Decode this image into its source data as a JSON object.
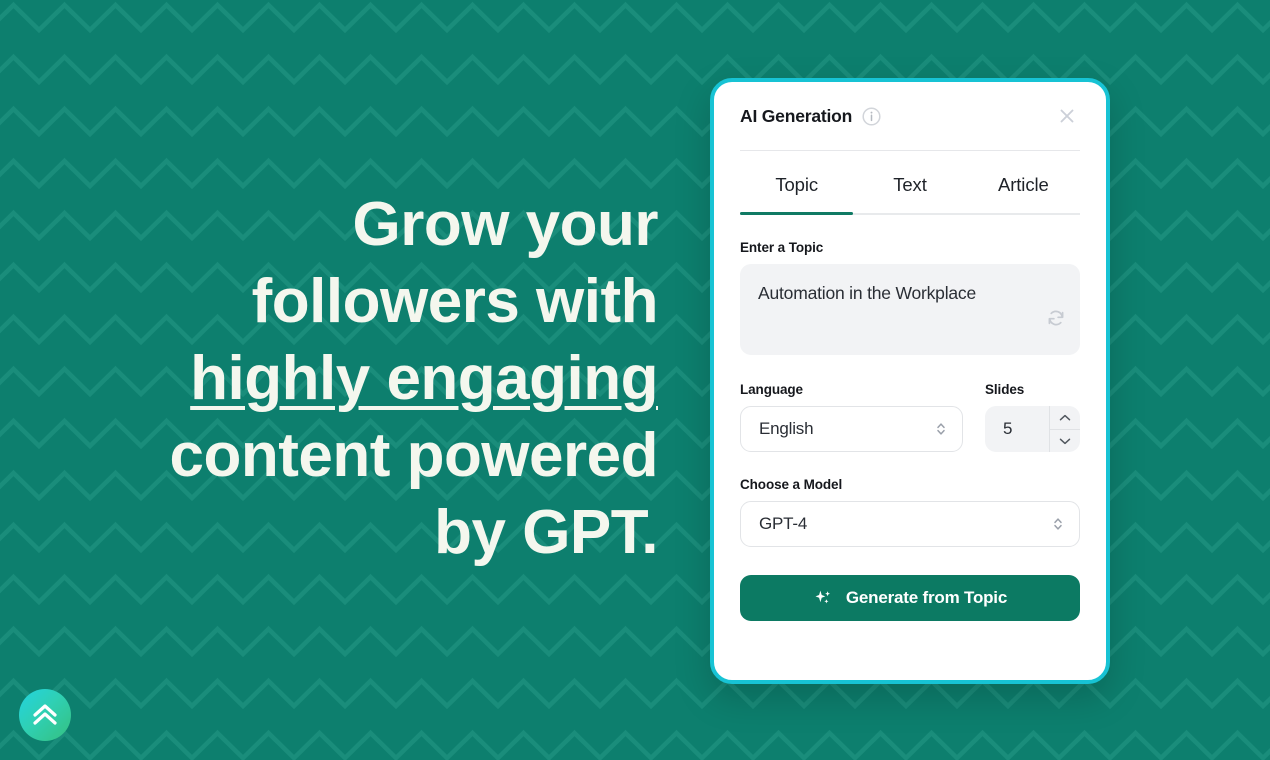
{
  "theme": {
    "background_teal": "#0d7f6e",
    "pattern_stroke": "#1a8d7b",
    "modal_border_cyan": "#17c3d4",
    "accent_green": "#0c7a63",
    "tab_underline": "#107a64",
    "headline_color": "#f4f7ee",
    "logo_gradient_from": "#22d3e0",
    "logo_gradient_to": "#35c07f"
  },
  "hero": {
    "line1": "Grow your",
    "line2": "followers with",
    "line3_underlined": "highly engaging",
    "line4": "content powered",
    "line5": "by GPT.",
    "full_text": "Grow your followers with highly engaging content powered by GPT."
  },
  "logo": {
    "icon": "double-chevron-up-icon",
    "alt": "brand-logo"
  },
  "modal": {
    "title": "AI Generation",
    "info_icon": "info-circle-icon",
    "close_icon": "close-x-icon",
    "tabs": [
      {
        "id": "topic",
        "label": "Topic",
        "active": true
      },
      {
        "id": "text",
        "label": "Text",
        "active": false
      },
      {
        "id": "article",
        "label": "Article",
        "active": false
      }
    ],
    "topic_field": {
      "label": "Enter a Topic",
      "value": "Automation in the Workplace",
      "placeholder": "Enter a Topic",
      "refresh_icon": "refresh-icon"
    },
    "language_field": {
      "label": "Language",
      "value": "English",
      "chevron_icon": "chevron-up-down-icon"
    },
    "slides_field": {
      "label": "Slides",
      "value": "5",
      "increment_icon": "chevron-up-icon",
      "decrement_icon": "chevron-down-icon"
    },
    "model_field": {
      "label": "Choose a Model",
      "value": "GPT-4",
      "chevron_icon": "chevron-up-down-icon"
    },
    "generate_button": {
      "label": "Generate from Topic",
      "icon": "sparkle-icon"
    }
  }
}
